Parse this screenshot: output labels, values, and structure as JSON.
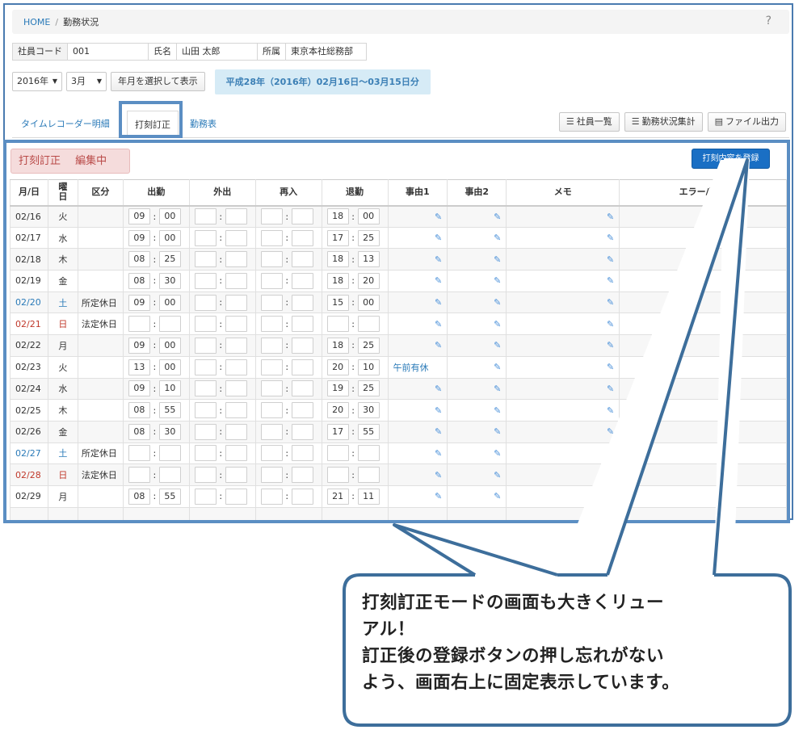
{
  "breadcrumb": {
    "home": "HOME",
    "separator": "/",
    "current": "勤務状況",
    "help": "?"
  },
  "employee": {
    "code_label": "社員コード",
    "code": "001",
    "name_label": "氏名",
    "name": "山田 太郎",
    "dept_label": "所属",
    "dept": "東京本社総務部"
  },
  "period": {
    "year": "2016年",
    "month": "3月",
    "select_button": "年月を選択して表示",
    "banner": "平成28年（2016年）02月16日〜03月15日分"
  },
  "tabs": [
    {
      "label": "タイムレコーダー明細"
    },
    {
      "label": "打刻訂正"
    },
    {
      "label": "勤務表"
    }
  ],
  "toolbar": {
    "employee_list": "社員一覧",
    "summary": "勤務状況集計",
    "file_output": "ファイル出力"
  },
  "edit": {
    "badge_mode": "打刻訂正",
    "badge_state": "編集中",
    "register_button": "打刻内容を登録"
  },
  "table": {
    "headers": {
      "date": "月/日",
      "weekday": "曜日",
      "category": "区分",
      "clock_in": "出勤",
      "out": "外出",
      "return": "再入",
      "clock_out": "退勤",
      "reason1": "事由1",
      "reason2": "事由2",
      "memo": "メモ",
      "error": "エラー/警告"
    },
    "rows": [
      {
        "date": "02/16",
        "weekday": "火",
        "type": "normal",
        "category": "",
        "in_h": "09",
        "in_m": "00",
        "out_h": "18",
        "out_m": "00",
        "reason1": ""
      },
      {
        "date": "02/17",
        "weekday": "水",
        "type": "normal",
        "category": "",
        "in_h": "09",
        "in_m": "00",
        "out_h": "17",
        "out_m": "25",
        "reason1": ""
      },
      {
        "date": "02/18",
        "weekday": "木",
        "type": "normal",
        "category": "",
        "in_h": "08",
        "in_m": "25",
        "out_h": "18",
        "out_m": "13",
        "reason1": ""
      },
      {
        "date": "02/19",
        "weekday": "金",
        "type": "normal",
        "category": "",
        "in_h": "08",
        "in_m": "30",
        "out_h": "18",
        "out_m": "20",
        "reason1": ""
      },
      {
        "date": "02/20",
        "weekday": "土",
        "type": "sat",
        "category": "所定休日",
        "in_h": "09",
        "in_m": "00",
        "out_h": "15",
        "out_m": "00",
        "reason1": ""
      },
      {
        "date": "02/21",
        "weekday": "日",
        "type": "sun",
        "category": "法定休日",
        "in_h": "",
        "in_m": "",
        "out_h": "",
        "out_m": "",
        "reason1": ""
      },
      {
        "date": "02/22",
        "weekday": "月",
        "type": "normal",
        "category": "",
        "in_h": "09",
        "in_m": "00",
        "out_h": "18",
        "out_m": "25",
        "reason1": ""
      },
      {
        "date": "02/23",
        "weekday": "火",
        "type": "normal",
        "category": "",
        "in_h": "13",
        "in_m": "00",
        "out_h": "20",
        "out_m": "10",
        "reason1": "午前有休"
      },
      {
        "date": "02/24",
        "weekday": "水",
        "type": "normal",
        "category": "",
        "in_h": "09",
        "in_m": "10",
        "out_h": "19",
        "out_m": "25",
        "reason1": ""
      },
      {
        "date": "02/25",
        "weekday": "木",
        "type": "normal",
        "category": "",
        "in_h": "08",
        "in_m": "55",
        "out_h": "20",
        "out_m": "30",
        "reason1": ""
      },
      {
        "date": "02/26",
        "weekday": "金",
        "type": "normal",
        "category": "",
        "in_h": "08",
        "in_m": "30",
        "out_h": "17",
        "out_m": "55",
        "reason1": ""
      },
      {
        "date": "02/27",
        "weekday": "土",
        "type": "sat",
        "category": "所定休日",
        "in_h": "",
        "in_m": "",
        "out_h": "",
        "out_m": "",
        "reason1": ""
      },
      {
        "date": "02/28",
        "weekday": "日",
        "type": "sun",
        "category": "法定休日",
        "in_h": "",
        "in_m": "",
        "out_h": "",
        "out_m": "",
        "reason1": ""
      },
      {
        "date": "02/29",
        "weekday": "月",
        "type": "normal",
        "category": "",
        "in_h": "08",
        "in_m": "55",
        "out_h": "21",
        "out_m": "11",
        "reason1": ""
      }
    ]
  },
  "callout": {
    "line1": "打刻訂正モードの画面も大きくリュー",
    "line2": "アル！",
    "line3": "訂正後の登録ボタンの押し忘れがない",
    "line4": "よう、画面右上に固定表示しています。"
  },
  "colors": {
    "accent": "#5b8ec3",
    "link": "#2a7ab8",
    "sunday": "#c0392b",
    "primary_button": "#1a6fc4",
    "edit_badge": "#f5dcdc"
  },
  "icons": {
    "pencil": "pencil-icon",
    "list": "list-icon",
    "file": "file-icon"
  }
}
